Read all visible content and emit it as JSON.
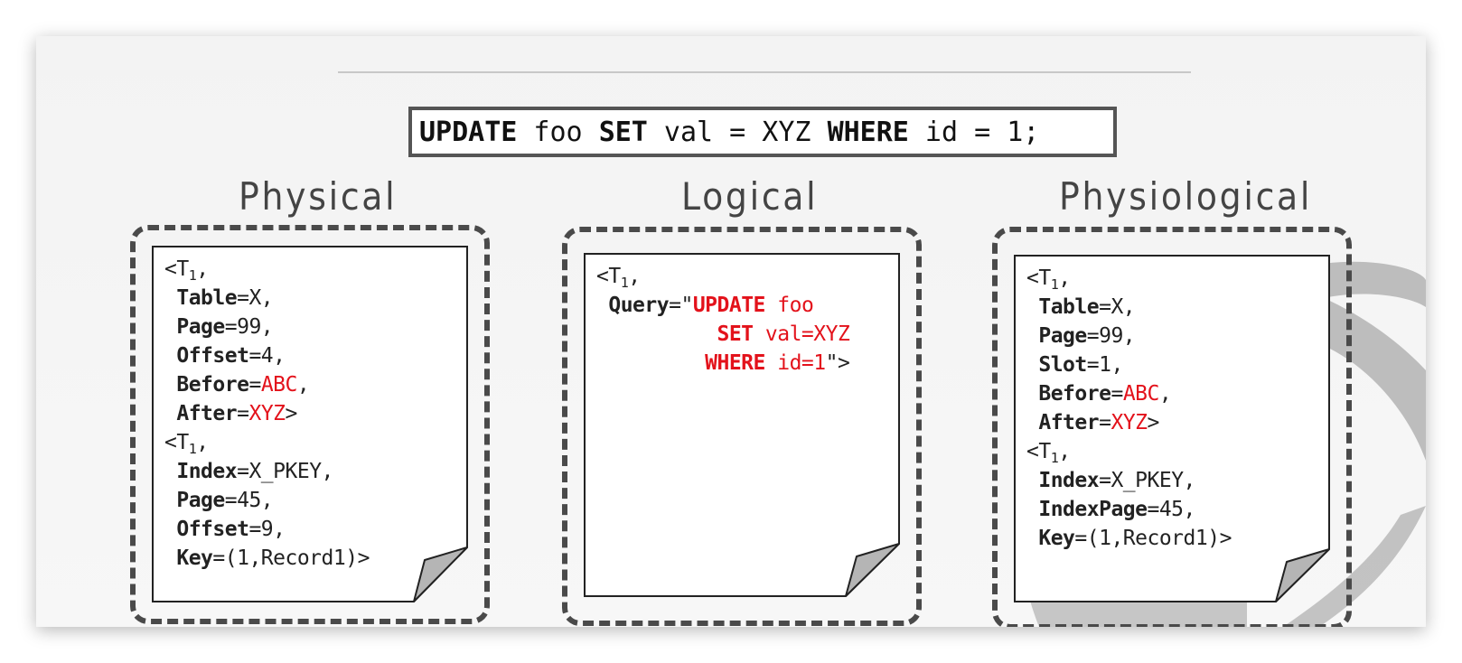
{
  "sql": {
    "kw_update": "UPDATE",
    "table": " foo ",
    "kw_set": "SET",
    "assign": " val = XYZ ",
    "kw_where": "WHERE",
    "cond": " id = 1;"
  },
  "headings": {
    "physical": "Physical",
    "logical": "Logical",
    "physiological": "Physiological"
  },
  "physical": {
    "rec1": {
      "open": "<T",
      "sub": "1",
      "comma": ",",
      "table_key": "Table",
      "table_val": "=X,",
      "page_key": "Page",
      "page_val": "=99,",
      "offset_key": "Offset",
      "offset_val": "=4,",
      "before_key": "Before",
      "before_eq": "=",
      "before_val": "ABC",
      "before_end": ",",
      "after_key": "After",
      "after_eq": "=",
      "after_val": "XYZ",
      "after_end": ">"
    },
    "rec2": {
      "open": "<T",
      "sub": "1",
      "comma": ",",
      "index_key": "Index",
      "index_val": "=X_PKEY,",
      "page_key": "Page",
      "page_val": "=45,",
      "offset_key": "Offset",
      "offset_val": "=9,",
      "key_key": "Key",
      "key_val": "=(1,Record1)>"
    }
  },
  "logical": {
    "open": "<T",
    "sub": "1",
    "comma": ",",
    "query_key": "Query",
    "query_eq": "=\"",
    "q_update": "UPDATE",
    "q_foo": " foo",
    "q_set": "SET",
    "q_val": " val=XYZ",
    "q_where": "WHERE",
    "q_id": " id=1",
    "q_end": "\">"
  },
  "physiological": {
    "rec1": {
      "open": "<T",
      "sub": "1",
      "comma": ",",
      "table_key": "Table",
      "table_val": "=X,",
      "page_key": "Page",
      "page_val": "=99,",
      "slot_key": "Slot",
      "slot_val": "=1,",
      "before_key": "Before",
      "before_eq": "=",
      "before_val": "ABC",
      "before_end": ",",
      "after_key": "After",
      "after_eq": "=",
      "after_val": "XYZ",
      "after_end": ">"
    },
    "rec2": {
      "open": "<T",
      "sub": "1",
      "comma": ",",
      "index_key": "Index",
      "index_val": "=X_PKEY,",
      "indexpage_key": "IndexPage",
      "indexpage_val": "=45,",
      "key_key": "Key",
      "key_val": "=(1,Record1)>"
    }
  },
  "colors": {
    "highlight": "#e3121b",
    "border": "#4a4a4a",
    "text": "#222222"
  }
}
